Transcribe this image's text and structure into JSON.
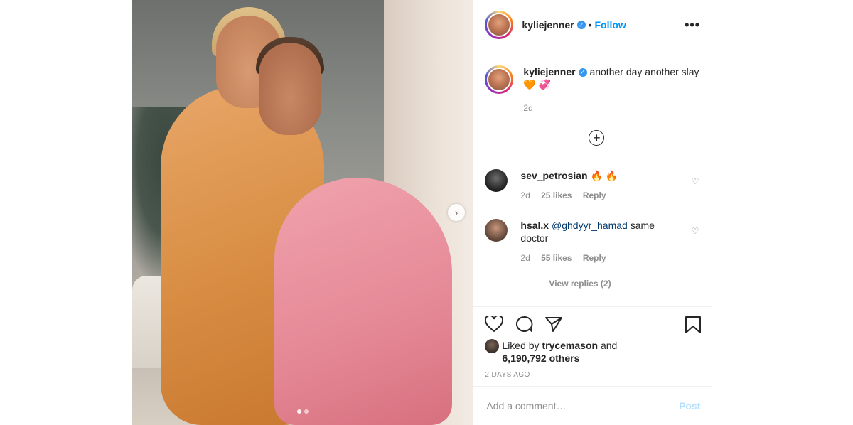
{
  "post": {
    "username": "kyliejenner",
    "follow_label": "Follow",
    "separator": "•",
    "more_icon": "•••",
    "next_arrow": "›"
  },
  "caption": {
    "username": "kyliejenner",
    "text": "another day another slay",
    "emoji": "🧡 💞",
    "time": "2d"
  },
  "add_icon": "+",
  "comments": [
    {
      "username": "sev_petrosian",
      "text": "🔥 🔥",
      "mention": "",
      "time": "2d",
      "likes": "25 likes",
      "reply": "Reply"
    },
    {
      "username": "hsal.x",
      "mention": "@ghdyyr_hamad",
      "text": "same doctor",
      "time": "2d",
      "likes": "55 likes",
      "reply": "Reply"
    }
  ],
  "view_replies": "View replies (2)",
  "likes": {
    "prefix": "Liked by",
    "user": "trycemason",
    "and": "and",
    "count": "6,190,792 others"
  },
  "posted": "2 DAYS AGO",
  "comment_box": {
    "placeholder": "Add a comment…",
    "post_label": "Post"
  },
  "colors": {
    "link": "#0095f6",
    "muted": "#8e8e8e",
    "verified": "#3897f0"
  },
  "icons": [
    "heart-icon",
    "comment-icon",
    "share-icon",
    "bookmark-icon",
    "more-icon",
    "add-icon",
    "chevron-right-icon",
    "verified-icon"
  ]
}
